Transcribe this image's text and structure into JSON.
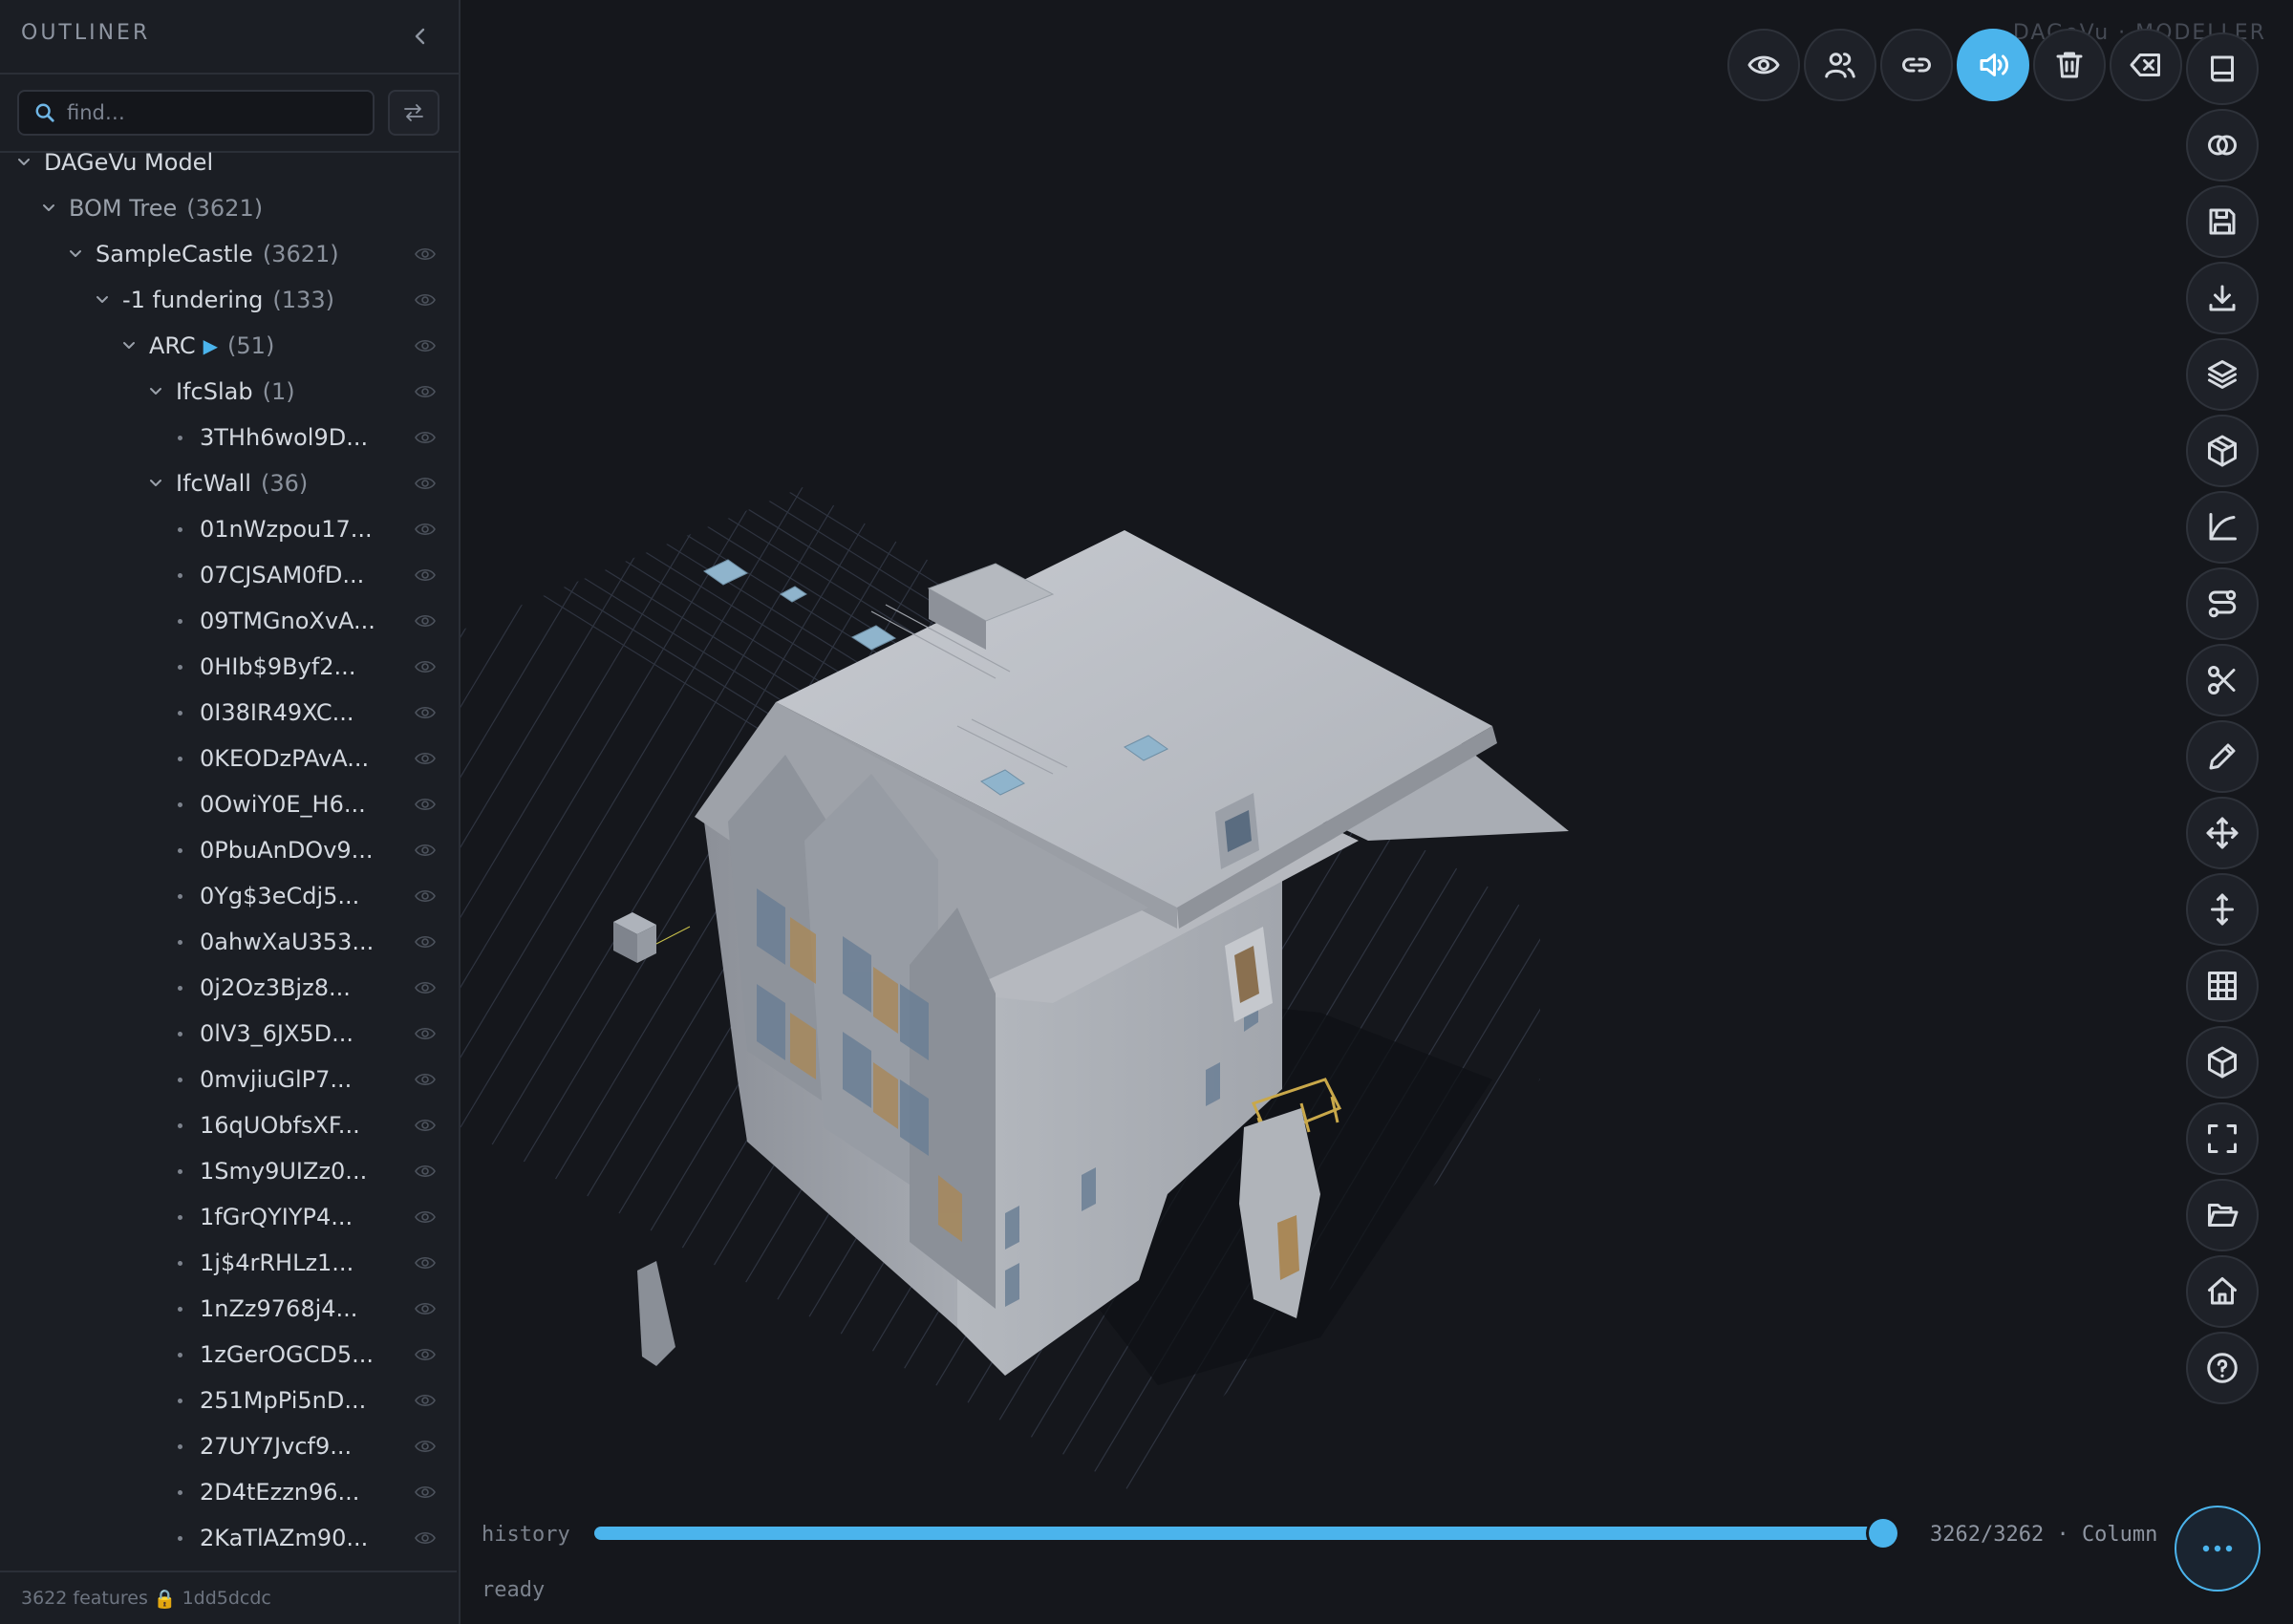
{
  "outliner": {
    "title": "OUTLINER",
    "search_placeholder": "find…",
    "tree": [
      {
        "label": "DAGeVu Model",
        "count": "",
        "depth": 0,
        "kind": "group",
        "eye": false,
        "muted": false
      },
      {
        "label": "BOM Tree",
        "count": "(3621)",
        "depth": 1,
        "kind": "group",
        "eye": false,
        "muted": true
      },
      {
        "label": "SampleCastle",
        "count": "(3621)",
        "depth": 2,
        "kind": "group",
        "eye": true,
        "muted": false
      },
      {
        "label": "-1 fundering",
        "count": "(133)",
        "depth": 3,
        "kind": "group",
        "eye": true,
        "muted": false
      },
      {
        "label": "ARC",
        "count": "(51)",
        "depth": 4,
        "kind": "group",
        "eye": true,
        "muted": false,
        "play": "▶"
      },
      {
        "label": "IfcSlab",
        "count": "(1)",
        "depth": 5,
        "kind": "group",
        "eye": true,
        "muted": false
      },
      {
        "label": "3THh6wol9D...",
        "count": "",
        "depth": 6,
        "kind": "leaf",
        "eye": true,
        "muted": false
      },
      {
        "label": "IfcWall",
        "count": "(36)",
        "depth": 5,
        "kind": "group",
        "eye": true,
        "muted": false
      },
      {
        "label": "01nWzpou17...",
        "count": "",
        "depth": 6,
        "kind": "leaf",
        "eye": true,
        "muted": false
      },
      {
        "label": "07CJSAM0fD...",
        "count": "",
        "depth": 6,
        "kind": "leaf",
        "eye": true,
        "muted": false
      },
      {
        "label": "09TMGnoXvA...",
        "count": "",
        "depth": 6,
        "kind": "leaf",
        "eye": true,
        "muted": false
      },
      {
        "label": "0HIb$9Byf2...",
        "count": "",
        "depth": 6,
        "kind": "leaf",
        "eye": true,
        "muted": false
      },
      {
        "label": "0I38IR49XC...",
        "count": "",
        "depth": 6,
        "kind": "leaf",
        "eye": true,
        "muted": false
      },
      {
        "label": "0KEODzPAvA...",
        "count": "",
        "depth": 6,
        "kind": "leaf",
        "eye": true,
        "muted": false
      },
      {
        "label": "0OwiY0E_H6...",
        "count": "",
        "depth": 6,
        "kind": "leaf",
        "eye": true,
        "muted": false
      },
      {
        "label": "0PbuAnDOv9...",
        "count": "",
        "depth": 6,
        "kind": "leaf",
        "eye": true,
        "muted": false
      },
      {
        "label": "0Yg$3eCdj5...",
        "count": "",
        "depth": 6,
        "kind": "leaf",
        "eye": true,
        "muted": false
      },
      {
        "label": "0ahwXaU353...",
        "count": "",
        "depth": 6,
        "kind": "leaf",
        "eye": true,
        "muted": false
      },
      {
        "label": "0j2Oz3Bjz8...",
        "count": "",
        "depth": 6,
        "kind": "leaf",
        "eye": true,
        "muted": false
      },
      {
        "label": "0lV3_6JX5D...",
        "count": "",
        "depth": 6,
        "kind": "leaf",
        "eye": true,
        "muted": false
      },
      {
        "label": "0mvjiuGlP7...",
        "count": "",
        "depth": 6,
        "kind": "leaf",
        "eye": true,
        "muted": false
      },
      {
        "label": "16qUObfsXF...",
        "count": "",
        "depth": 6,
        "kind": "leaf",
        "eye": true,
        "muted": false
      },
      {
        "label": "1Smy9UIZz0...",
        "count": "",
        "depth": 6,
        "kind": "leaf",
        "eye": true,
        "muted": false
      },
      {
        "label": "1fGrQYIYP4...",
        "count": "",
        "depth": 6,
        "kind": "leaf",
        "eye": true,
        "muted": false
      },
      {
        "label": "1j$4rRHLz1...",
        "count": "",
        "depth": 6,
        "kind": "leaf",
        "eye": true,
        "muted": false
      },
      {
        "label": "1nZz9768j4...",
        "count": "",
        "depth": 6,
        "kind": "leaf",
        "eye": true,
        "muted": false
      },
      {
        "label": "1zGerOGCD5...",
        "count": "",
        "depth": 6,
        "kind": "leaf",
        "eye": true,
        "muted": false
      },
      {
        "label": "251MpPi5nD...",
        "count": "",
        "depth": 6,
        "kind": "leaf",
        "eye": true,
        "muted": false
      },
      {
        "label": "27UY7Jvcf9...",
        "count": "",
        "depth": 6,
        "kind": "leaf",
        "eye": true,
        "muted": false
      },
      {
        "label": "2D4tEzzn96...",
        "count": "",
        "depth": 6,
        "kind": "leaf",
        "eye": true,
        "muted": false
      },
      {
        "label": "2KaTlAZm90...",
        "count": "",
        "depth": 6,
        "kind": "leaf",
        "eye": true,
        "muted": false
      }
    ],
    "footer": {
      "features": "3622 features",
      "lock_icon": "🔒",
      "hash": "1dd5dcdc"
    }
  },
  "viewport": {
    "watermark": "DAGeVu · MODELLER",
    "top_toolbar": [
      {
        "name": "visibility",
        "icon": "eye-icon",
        "active": false
      },
      {
        "name": "users",
        "icon": "users-icon",
        "active": false
      },
      {
        "name": "link",
        "icon": "link-icon",
        "active": false
      },
      {
        "name": "audio",
        "icon": "speaker-icon",
        "active": true
      },
      {
        "name": "delete",
        "icon": "trash-icon",
        "active": false
      },
      {
        "name": "clear",
        "icon": "backspace-icon",
        "active": false
      }
    ],
    "side_toolbar": [
      {
        "name": "docs",
        "icon": "book-icon"
      },
      {
        "name": "boolean",
        "icon": "intersect-icon"
      },
      {
        "name": "save",
        "icon": "save-icon"
      },
      {
        "name": "download",
        "icon": "download-icon"
      },
      {
        "name": "layers",
        "icon": "layers-icon"
      },
      {
        "name": "package",
        "icon": "box-icon"
      },
      {
        "name": "curve",
        "icon": "curve-icon"
      },
      {
        "name": "route",
        "icon": "route-icon"
      },
      {
        "name": "cut",
        "icon": "scissors-icon"
      },
      {
        "name": "draw",
        "icon": "pencil-icon"
      },
      {
        "name": "move",
        "icon": "move-icon"
      },
      {
        "name": "elevate",
        "icon": "vertical-move-icon"
      },
      {
        "name": "grid",
        "icon": "grid-icon"
      },
      {
        "name": "solid",
        "icon": "cube-icon"
      },
      {
        "name": "fullscreen",
        "icon": "fullscreen-icon"
      },
      {
        "name": "open",
        "icon": "folder-open-icon"
      },
      {
        "name": "home",
        "icon": "home-icon"
      },
      {
        "name": "help",
        "icon": "help-icon"
      }
    ],
    "history": {
      "label": "history",
      "value": "3262/3262 · Column",
      "position": 3262,
      "total": 3262
    },
    "status": "ready",
    "more_icon": "more-horizontal-icon",
    "accent_color": "#4bb4ec"
  }
}
